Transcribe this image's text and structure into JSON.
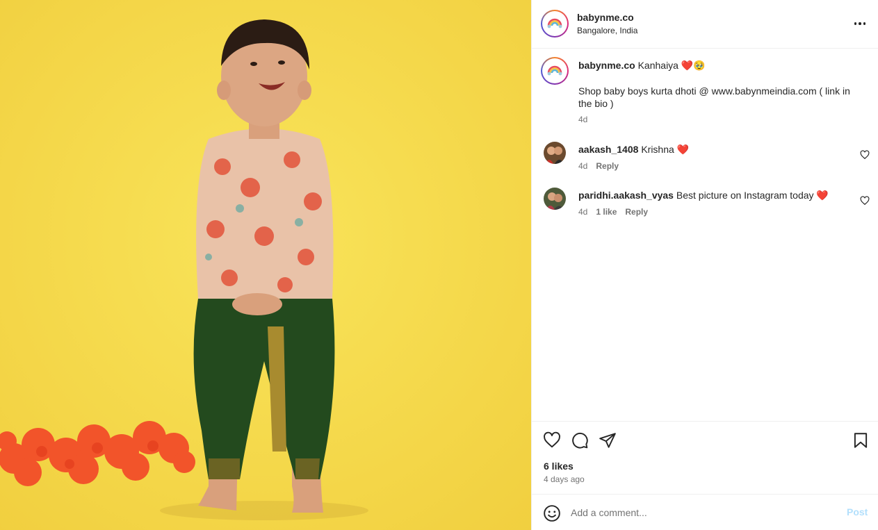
{
  "post": {
    "username": "babynme.co",
    "location": "Bangalore, India",
    "more_icon": "more-horizontal-icon",
    "caption": {
      "username": "babynme.co",
      "title_text": "Kanhaiya ❤️🥹",
      "body_text": "Shop baby boys kurta dhoti @ www.babynmeindia.com ( link in the bio )",
      "time": "4d"
    },
    "comments": [
      {
        "username": "aakash_1408",
        "text": "Krishna ❤️",
        "time": "4d",
        "likes": "",
        "reply_label": "Reply"
      },
      {
        "username": "paridhi.aakash_vyas",
        "text": "Best picture on Instagram today ❤️",
        "time": "4d",
        "likes": "1 like",
        "reply_label": "Reply"
      }
    ],
    "actions": {
      "like_icon": "heart-icon",
      "comment_icon": "comment-icon",
      "share_icon": "send-icon",
      "save_icon": "bookmark-icon"
    },
    "likes": "6 likes",
    "date": "4 days ago",
    "add_comment": {
      "placeholder": "Add a comment...",
      "post_label": "Post",
      "emoji_icon": "emoji-icon"
    },
    "colors": {
      "background_photo": "#f5d94f",
      "post_button_disabled": "#b2dffc",
      "secondary_text": "#737373"
    }
  }
}
